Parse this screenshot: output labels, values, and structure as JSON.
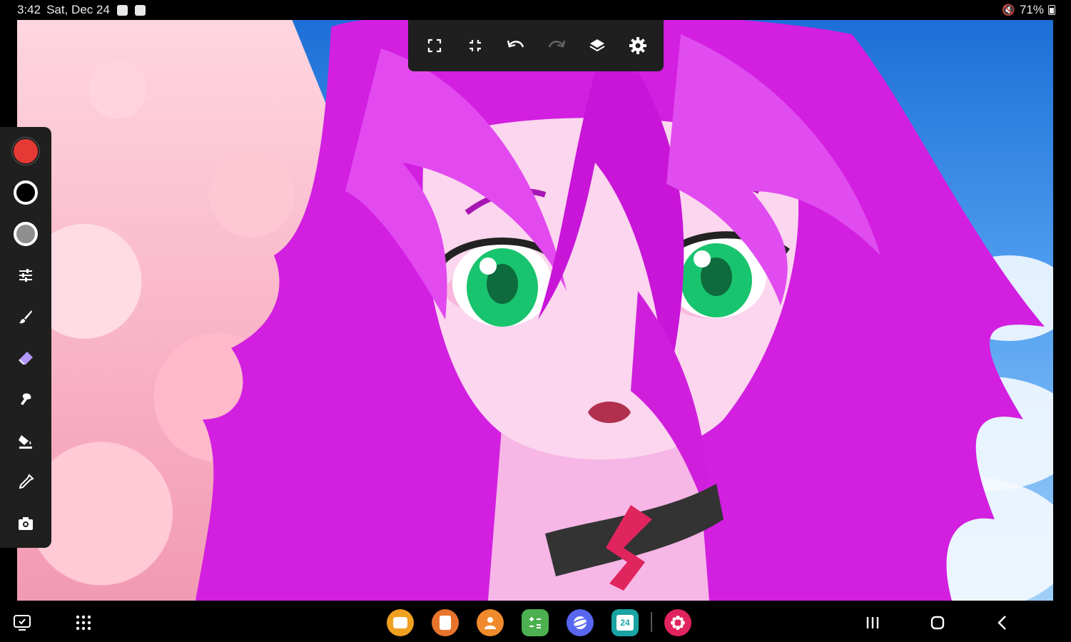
{
  "status_bar": {
    "time": "3:42",
    "date": "Sat, Dec 24",
    "battery": "71%"
  },
  "top_toolbar": {
    "buttons": [
      "fullscreen-icon",
      "fit-screen-icon",
      "undo-icon",
      "redo-icon",
      "layers-icon",
      "settings-icon"
    ]
  },
  "left_panel": {
    "colors": {
      "primary": "#e53935",
      "secondary": "#000000",
      "tertiary": "#8e8e8e"
    },
    "tools": [
      "adjustments-icon",
      "brush-icon",
      "eraser-icon",
      "smudge-icon",
      "fill-bucket-icon",
      "eyedropper-icon",
      "camera-icon"
    ],
    "active_tool": "eraser-icon",
    "active_color": "#b497ff"
  },
  "taskbar": {
    "apps": [
      {
        "name": "messages-app-icon",
        "color": "#f0a020"
      },
      {
        "name": "notes-app-icon",
        "color": "#e8742c"
      },
      {
        "name": "contacts-app-icon",
        "color": "#f08a2c"
      },
      {
        "name": "calculator-app-icon",
        "color": "#4caf50"
      },
      {
        "name": "browser-app-icon",
        "color": "#5866f0"
      },
      {
        "name": "calendar-app-icon",
        "color": "#1aa3a3"
      },
      {
        "name": "bixby-app-icon",
        "color": "#e0245e"
      }
    ],
    "calendar_date": "24"
  }
}
